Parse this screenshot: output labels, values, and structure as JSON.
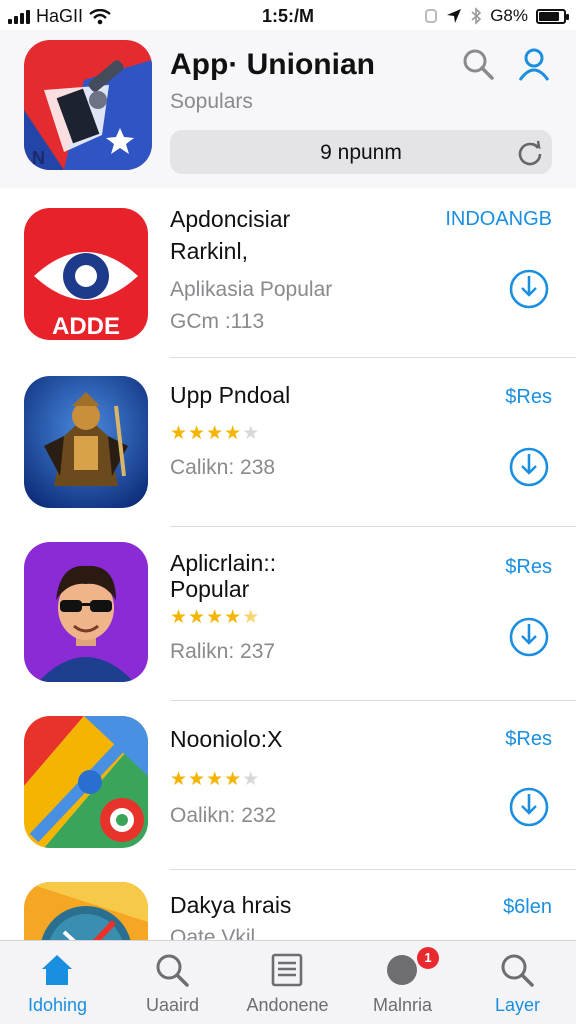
{
  "status_bar": {
    "carrier": "HaGII",
    "time": "1:5:/M",
    "battery": "G8%",
    "battery_level": 0.85
  },
  "header": {
    "title": "App· Unionian",
    "subtitle": "Sopulars",
    "search_query": "9 npunm"
  },
  "apps": [
    {
      "name_line1": "Apdoncisiar",
      "name_line2": "Rarkinl,",
      "subtitle": "Aplikasia Popular",
      "meta": "GCm :113",
      "price": "INDOANGB",
      "rating": null,
      "icon_text": "ADDE"
    },
    {
      "name_line1": "Upp Pndoal",
      "name_line2": "",
      "subtitle": "",
      "meta": "Calikn: 238",
      "price": "$Res",
      "rating": 4
    },
    {
      "name_line1": "Aplicrlain::",
      "name_line2": "Popular",
      "subtitle": "",
      "meta": "Ralikn: 237",
      "price": "$Res",
      "rating": 4.5
    },
    {
      "name_line1": "Nooniolo:X",
      "name_line2": "",
      "subtitle": "",
      "meta": "Oalikn: 232",
      "price": "$Res",
      "rating": 4
    },
    {
      "name_line1": "Dakya hrais",
      "name_line2": "",
      "subtitle": "",
      "meta": "Oate Vkil",
      "price": "$6len",
      "rating": null
    }
  ],
  "tabbar": {
    "tabs": [
      {
        "label": "Idohing",
        "icon": "home-icon",
        "active": true
      },
      {
        "label": "Uaaird",
        "icon": "search-icon",
        "active": false
      },
      {
        "label": "Andonene",
        "icon": "list-icon",
        "active": false
      },
      {
        "label": "Malnria",
        "icon": "compass-icon",
        "active": false,
        "badge": "1"
      },
      {
        "label": "Layer",
        "icon": "search-icon",
        "active": true
      }
    ]
  },
  "colors": {
    "accent": "#1a8fe0",
    "star": "#f5b400",
    "badge": "#e8292f"
  }
}
